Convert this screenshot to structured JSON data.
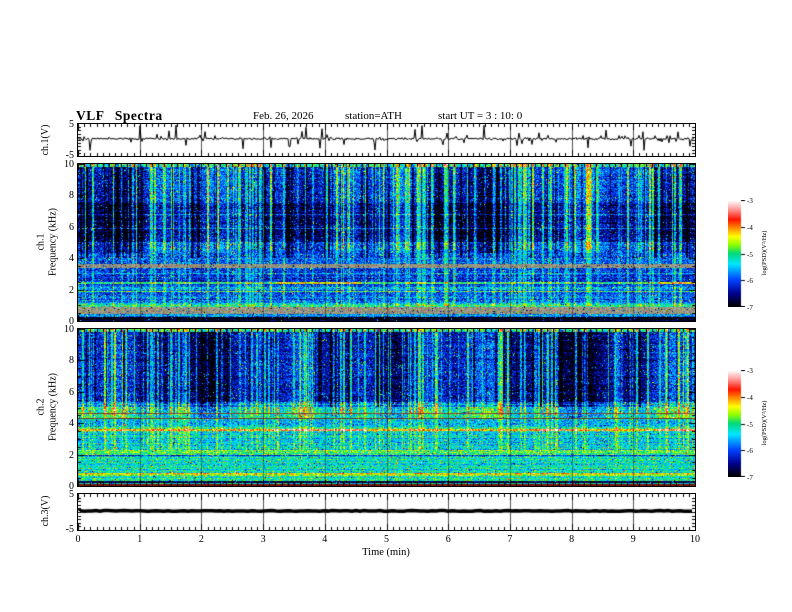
{
  "header": {
    "title": "VLF Spectra",
    "date": "Feb. 26, 2026",
    "station": "station=ATH",
    "start_ut": "start UT =  3 : 10: 0"
  },
  "x_axis": {
    "label": "Time (min)",
    "range": [
      0,
      10
    ],
    "ticks": [
      "0",
      "1",
      "2",
      "3",
      "4",
      "5",
      "6",
      "7",
      "8",
      "9",
      "10"
    ],
    "minor_step": 0.1
  },
  "colorbar": {
    "label": "log(PSD)(V²/Hz)",
    "ticks": [
      "-3",
      "-4",
      "-5",
      "-6",
      "-7"
    ],
    "range": [
      -7,
      -3
    ],
    "stops": [
      [
        0,
        "#000000"
      ],
      [
        0.12,
        "#00008c"
      ],
      [
        0.25,
        "#0042ff"
      ],
      [
        0.4,
        "#00e8ff"
      ],
      [
        0.5,
        "#00d97a"
      ],
      [
        0.58,
        "#8cff00"
      ],
      [
        0.66,
        "#ffff00"
      ],
      [
        0.74,
        "#ff8c00"
      ],
      [
        0.82,
        "#ff1400"
      ],
      [
        0.92,
        "#ff9e9e"
      ],
      [
        1,
        "#ffffff"
      ]
    ]
  },
  "chart_data": [
    {
      "type": "line",
      "name": "ch1-waveform",
      "ylabel": "ch.1(V)",
      "ylim": [
        -5,
        5
      ],
      "yticks": [
        "5",
        "-5"
      ],
      "x_range": [
        0,
        10
      ],
      "seed": 42,
      "mean": 0.4,
      "noise_sigma": 0.38,
      "spike_rate": 0.12,
      "spike_amp": [
        0.6,
        4.4
      ],
      "neg_bias": 0.55
    },
    {
      "type": "spectrogram",
      "name": "ch1-spectrogram",
      "ylabel_lines": [
        "ch.1",
        "Frequency (kHz)"
      ],
      "ylim": [
        0,
        10
      ],
      "yticks": [
        "10",
        "8",
        "6",
        "4",
        "2",
        "0"
      ],
      "zlabel": "log(PSD)(V²/Hz)",
      "zlim": [
        -7,
        -3
      ],
      "x_range": [
        0,
        10
      ],
      "seed": 7,
      "noise_sigma": 0.5,
      "bands": [
        {
          "f": [
            0,
            0.28
          ],
          "level": -6.9
        },
        {
          "f": [
            0.28,
            0.42
          ],
          "level": -5.6
        },
        {
          "f": [
            0.42,
            0.88
          ],
          "level": -5.0,
          "gray": true
        },
        {
          "f": [
            0.88,
            1.12
          ],
          "level": -5.4
        },
        {
          "f": [
            1.12,
            2.3
          ],
          "level": -5.9
        },
        {
          "f": [
            2.3,
            3.35
          ],
          "level": -6.1
        },
        {
          "f": [
            3.35,
            3.62
          ],
          "level": -5.0,
          "gray": true
        },
        {
          "f": [
            3.62,
            5.0
          ],
          "level": -6.0
        },
        {
          "f": [
            5.0,
            7.5
          ],
          "level": -6.55
        },
        {
          "f": [
            7.5,
            9.8
          ],
          "level": -6.15
        },
        {
          "f": [
            9.8,
            10
          ],
          "level": -5.1
        }
      ],
      "lines": [
        {
          "f": 0.5,
          "w": 0.1,
          "level": -4.7
        },
        {
          "f": 0.95,
          "w": 0.1,
          "level": -5.1
        },
        {
          "f": 1.9,
          "w": 0.08,
          "level": -5.2
        },
        {
          "f": 2.12,
          "w": 0.07,
          "level": -5.35
        },
        {
          "f": 2.42,
          "w": 0.1,
          "level": -4.9,
          "segments": [
            {
              "x": [
                3.2,
                4.6
              ],
              "level": -4.2
            },
            {
              "x": [
                9.4,
                10
              ],
              "level": -4.15
            }
          ]
        },
        {
          "f": 3.0,
          "w": 0.06,
          "level": -5.6
        },
        {
          "f": 5.9,
          "w": 0.05,
          "level": -6.0
        },
        {
          "f": 6.8,
          "w": 0.05,
          "level": -5.9
        }
      ],
      "stripes": {
        "count": 150,
        "fmin": 0.95,
        "boost": [
          0.5,
          1.5
        ],
        "dark_count": 70,
        "dark_boost": -0.7,
        "dark_fmin": 4.0
      }
    },
    {
      "type": "spectrogram",
      "name": "ch2-spectrogram",
      "ylabel_lines": [
        "ch.2",
        "Frequency (kHz)"
      ],
      "ylim": [
        0,
        10
      ],
      "yticks": [
        "10",
        "8",
        "6",
        "4",
        "2",
        "0"
      ],
      "zlabel": "log(PSD)(V²/Hz)",
      "zlim": [
        -7,
        -3
      ],
      "x_range": [
        0,
        10
      ],
      "seed": 13,
      "noise_sigma": 0.5,
      "bands": [
        {
          "f": [
            0,
            0.1
          ],
          "level": -6.2,
          "color": "#7a1400"
        },
        {
          "f": [
            0.1,
            0.32
          ],
          "level": -6.9
        },
        {
          "f": [
            0.32,
            0.62
          ],
          "level": -5.25
        },
        {
          "f": [
            0.62,
            0.85
          ],
          "level": -4.75
        },
        {
          "f": [
            0.85,
            1.95
          ],
          "level": -5.3
        },
        {
          "f": [
            1.95,
            2.3
          ],
          "level": -4.85
        },
        {
          "f": [
            2.3,
            3.42
          ],
          "level": -5.45
        },
        {
          "f": [
            3.42,
            3.78
          ],
          "level": -5.05
        },
        {
          "f": [
            3.78,
            4.2
          ],
          "level": -5.55
        },
        {
          "f": [
            4.2,
            5.0
          ],
          "level": -5.35
        },
        {
          "f": [
            5.0,
            5.35
          ],
          "level": -5.9
        },
        {
          "f": [
            5.35,
            9.8
          ],
          "level": -6.4
        },
        {
          "f": [
            9.8,
            10
          ],
          "level": -5.1
        }
      ],
      "lines": [
        {
          "f": 0.18,
          "w": 0.05,
          "level": -5.3
        },
        {
          "f": 0.28,
          "w": 0.04,
          "level": -6.6,
          "dark": true
        },
        {
          "f": 0.75,
          "w": 0.12,
          "level": -4.5
        },
        {
          "f": 1.95,
          "w": 0.06,
          "level": -6.4,
          "dark": true
        },
        {
          "f": 2.15,
          "w": 0.09,
          "level": -4.75
        },
        {
          "f": 3.57,
          "w": 0.12,
          "level": -4.2,
          "segments": [
            {
              "x": [
                3.1,
                4.7
              ],
              "level": -3.65
            },
            {
              "x": [
                7.3,
                8.1
              ],
              "level": -3.8
            },
            {
              "x": [
                9.4,
                10
              ],
              "level": -3.7
            }
          ]
        },
        {
          "f": 4.32,
          "w": 0.06,
          "color": "#5f3a32"
        },
        {
          "f": 4.62,
          "w": 0.07,
          "color": "#7a4238"
        },
        {
          "f": 5.2,
          "w": 0.05,
          "level": -5.4
        }
      ],
      "stripes": {
        "count": 140,
        "fmin": 2.3,
        "boost": [
          0.5,
          1.4
        ],
        "dark_count": 60,
        "dark_boost": -0.7,
        "dark_fmin": 5.0
      }
    },
    {
      "type": "line",
      "name": "ch3-waveform",
      "ylabel": "ch.3(V)",
      "ylim": [
        -5,
        5
      ],
      "yticks": [
        "5",
        "-5"
      ],
      "x_range": [
        0,
        10
      ],
      "seed": 99,
      "mean": 0.3,
      "noise_sigma": 0.03,
      "flat": true,
      "thickness": 3.5
    }
  ]
}
